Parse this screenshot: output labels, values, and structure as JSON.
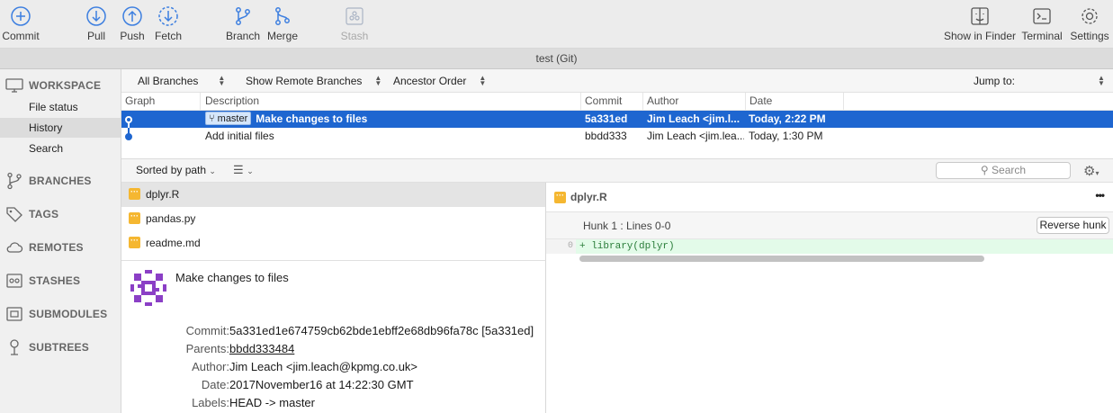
{
  "toolbar": {
    "commit": "Commit",
    "pull": "Pull",
    "push": "Push",
    "fetch": "Fetch",
    "branch": "Branch",
    "merge": "Merge",
    "stash": "Stash",
    "show_in_finder": "Show in Finder",
    "terminal": "Terminal",
    "settings": "Settings"
  },
  "window_title": "test (Git)",
  "sidebar": {
    "workspace": "WORKSPACE",
    "file_status": "File status",
    "history": "History",
    "search": "Search",
    "branches": "BRANCHES",
    "tags": "TAGS",
    "remotes": "REMOTES",
    "stashes": "STASHES",
    "submodules": "SUBMODULES",
    "subtrees": "SUBTREES"
  },
  "filter": {
    "branches": "All Branches",
    "remote": "Show Remote Branches",
    "order": "Ancestor Order",
    "jump_to": "Jump to:"
  },
  "columns": {
    "graph": "Graph",
    "description": "Description",
    "commit": "Commit",
    "author": "Author",
    "date": "Date"
  },
  "commits": [
    {
      "branch": "master",
      "description": "Make changes to files",
      "commit": "5a331ed",
      "author": "Jim Leach <jim.l...",
      "date": "Today, 2:22 PM"
    },
    {
      "branch": "",
      "description": "Add initial files",
      "commit": "bbdd333",
      "author": "Jim Leach <jim.lea...",
      "date": "Today, 1:30 PM"
    }
  ],
  "lower": {
    "sort": "Sorted by path",
    "search_placeholder": "Search"
  },
  "files": [
    "dplyr.R",
    "pandas.py",
    "readme.md"
  ],
  "details": {
    "message": "Make changes to files",
    "commit_label": "Commit:",
    "commit_value": "5a331ed1e674759cb62bde1ebff2e68db96fa78c [5a331ed]",
    "parents_label": "Parents:",
    "parents_value": "bbdd333484",
    "author_label": "Author:",
    "author_value": "Jim Leach <jim.leach@kpmg.co.uk>",
    "date_label": "Date:",
    "date_value": "2017November16 at 14:22:30 GMT",
    "labels_label": "Labels:",
    "labels_value": "HEAD -> master"
  },
  "diff": {
    "file": "dplyr.R",
    "hunk": "Hunk 1 : Lines 0-0",
    "reverse": "Reverse hunk",
    "line_no": "0",
    "line": "+ library(dplyr)",
    "more": "•••"
  },
  "colors": {
    "selection": "#1e66d0",
    "file_icon": "#f5b731",
    "added_bg": "#e3fbe9",
    "avatar": "#8b3fc6"
  }
}
